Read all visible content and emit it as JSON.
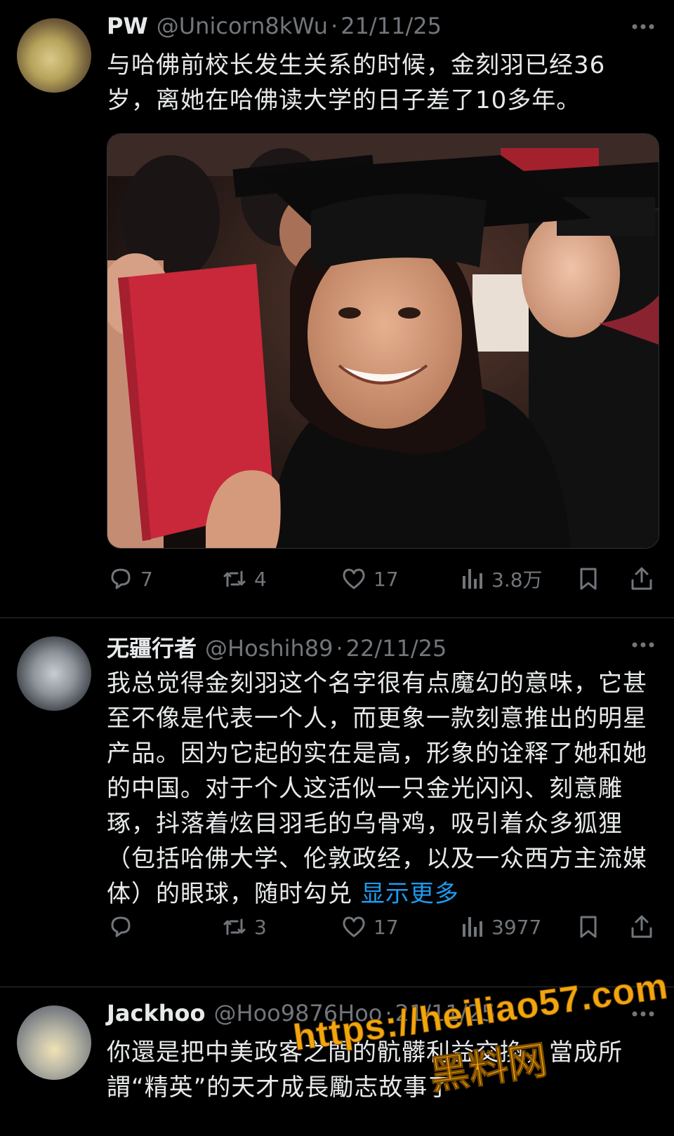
{
  "posts": [
    {
      "name": "PW",
      "handle": "@Unicorn8kWu",
      "separator": "·",
      "date": "21/11/25",
      "text": "与哈佛前校长发生关系的时候，金刻羽已经36岁，离她在哈佛读大学的日子差了10多年。",
      "has_media": true,
      "replies": "7",
      "retweets": "4",
      "likes": "17",
      "views": "3.8万"
    },
    {
      "name": "无疆行者",
      "handle": "@Hoshih89",
      "separator": "·",
      "date": "22/11/25",
      "text": "我总觉得金刻羽这个名字很有点魔幻的意味，它甚至不像是代表一个人，而更象一款刻意推出的明星产品。因为它起的实在是高，形象的诠释了她和她的中国。对于个人这活似一只金光闪闪、刻意雕琢，抖落着炫目羽毛的乌骨鸡，吸引着众多狐狸（包括哈佛大学、伦敦政经，以及一众西方主流媒体）的眼球，随时勾兑",
      "show_more": "显示更多",
      "replies": "",
      "retweets": "3",
      "likes": "17",
      "views": "3977"
    },
    {
      "name": "Jackhoo",
      "handle": "@Hoo9876Hoo",
      "separator": "·",
      "date": "21/11/25",
      "text": "你還是把中美政客之間的骯髒利益交換，當成所謂“精英”的天才成長勵志故事了"
    }
  ],
  "watermark": {
    "url": "https://heiliao57.com",
    "cn": "黑料网"
  },
  "icons": {
    "more": "more-dots-icon",
    "reply": "reply-icon",
    "retweet": "retweet-icon",
    "like": "heart-icon",
    "views": "views-icon",
    "bookmark": "bookmark-icon",
    "share": "share-icon"
  },
  "colors": {
    "background": "#000000",
    "text": "#e7e9ea",
    "muted": "#71767b",
    "link": "#1d9bf0",
    "divider": "#2f3336",
    "watermark": "#f2a60d"
  }
}
